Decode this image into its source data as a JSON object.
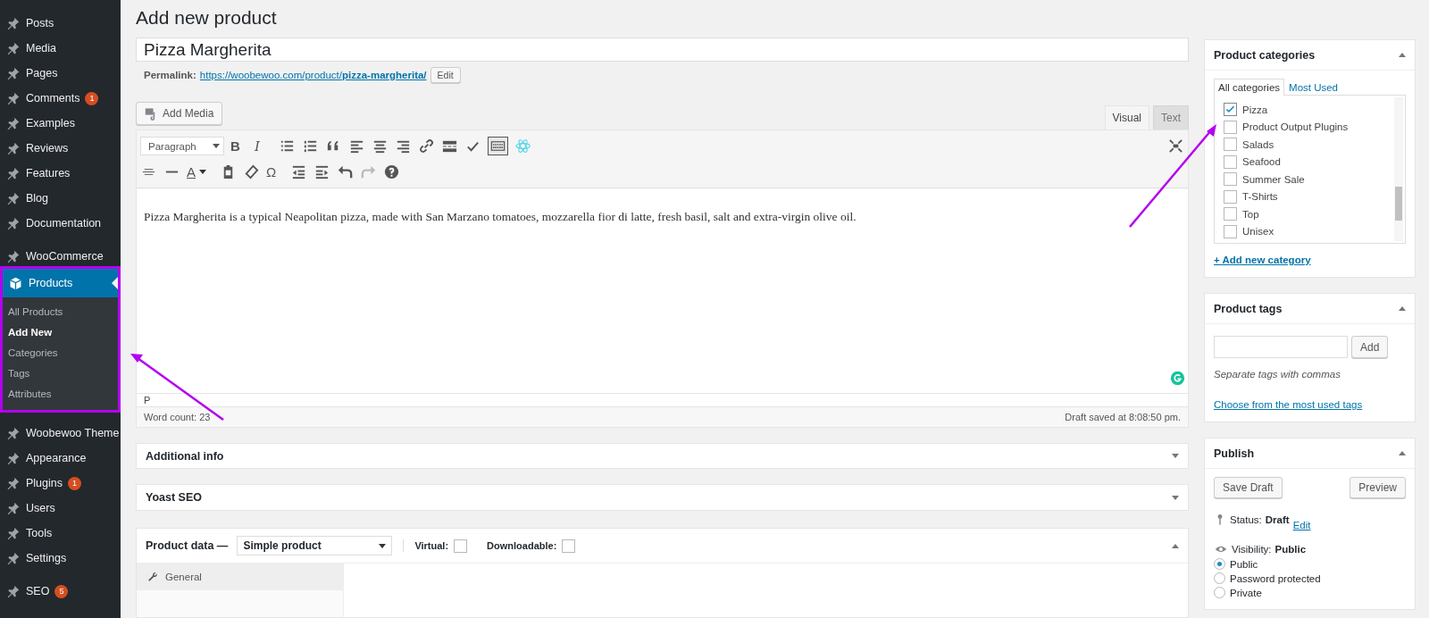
{
  "sidebar": {
    "groups": [
      {
        "items": [
          {
            "label": "Posts"
          },
          {
            "label": "Media"
          },
          {
            "label": "Pages"
          },
          {
            "label": "Comments",
            "badge": "1"
          },
          {
            "label": "Examples"
          },
          {
            "label": "Reviews"
          },
          {
            "label": "Features"
          },
          {
            "label": "Blog"
          },
          {
            "label": "Documentation"
          }
        ]
      },
      {
        "items": [
          {
            "label": "WooCommerce"
          },
          {
            "label": "Products",
            "current": true,
            "highlighted": true,
            "children": [
              {
                "label": "All Products",
                "selected": false
              },
              {
                "label": "Add New",
                "selected": true
              },
              {
                "label": "Categories",
                "selected": false
              },
              {
                "label": "Tags",
                "selected": false
              },
              {
                "label": "Attributes",
                "selected": false
              }
            ]
          }
        ]
      },
      {
        "items": [
          {
            "label": "Woobewoo Theme"
          },
          {
            "label": "Appearance"
          },
          {
            "label": "Plugins",
            "badge": "1"
          },
          {
            "label": "Users"
          },
          {
            "label": "Tools"
          },
          {
            "label": "Settings"
          }
        ]
      },
      {
        "items": [
          {
            "label": "SEO",
            "badge": "5"
          }
        ]
      }
    ]
  },
  "page_title": "Add new product",
  "product_title": {
    "value": "Pizza Margherita"
  },
  "permalink": {
    "label": "Permalink:",
    "url_base": "https://woobewoo.com/product/",
    "slug": "pizza-margherita/",
    "edit_button": "Edit"
  },
  "add_media_button": "Add Media",
  "editor_tabs": [
    {
      "label": "Visual",
      "selected": true
    },
    {
      "label": "Text",
      "selected": false
    }
  ],
  "toolbar": {
    "format_select": "Paragraph",
    "bold": "B",
    "italic": "I",
    "text_color": "A",
    "special_char": "Ω",
    "toolbar_toggle_pressed": true
  },
  "editor_content": "Pizza Margherita is a typical Neapolitan pizza, made with San Marzano tomatoes, mozzarella fior di latte, fresh basil, salt and extra-virgin olive oil.",
  "editor_path": "P",
  "word_count": "Word count: 23",
  "draft_saved": "Draft saved at 8:08:50 pm.",
  "collapsed_panels": [
    {
      "title": "Additional info"
    },
    {
      "title": "Yoast SEO"
    }
  ],
  "product_data": {
    "title": "Product data —",
    "type_select": "Simple product",
    "virtual": {
      "label": "Virtual:",
      "checked": false
    },
    "downloadable": {
      "label": "Downloadable:",
      "checked": false
    },
    "tabs": [
      {
        "label": "General",
        "selected": true
      }
    ]
  },
  "categories": {
    "title": "Product categories",
    "tabs": [
      {
        "label": "All categories",
        "selected": true
      },
      {
        "label": "Most Used",
        "selected": false
      }
    ],
    "items": [
      {
        "label": "Pizza",
        "checked": true
      },
      {
        "label": "Product Output Plugins",
        "checked": false
      },
      {
        "label": "Salads",
        "checked": false
      },
      {
        "label": "Seafood",
        "checked": false
      },
      {
        "label": "Summer Sale",
        "checked": false
      },
      {
        "label": "T-Shirts",
        "checked": false
      },
      {
        "label": "Top",
        "checked": false
      },
      {
        "label": "Unisex",
        "checked": false
      }
    ],
    "add_link": "+ Add new category"
  },
  "tags": {
    "title": "Product tags",
    "add_button": "Add",
    "hint": "Separate tags with commas",
    "choose_link": "Choose from the most used tags"
  },
  "publish": {
    "title": "Publish",
    "save_draft": "Save Draft",
    "preview": "Preview",
    "status_label": "Status:",
    "status_value": "Draft",
    "status_edit": "Edit",
    "visibility_label": "Visibility:",
    "visibility_value": "Public",
    "visibility_options": [
      {
        "label": "Public",
        "selected": true
      },
      {
        "label": "Password protected",
        "selected": false
      },
      {
        "label": "Private",
        "selected": false
      }
    ]
  }
}
